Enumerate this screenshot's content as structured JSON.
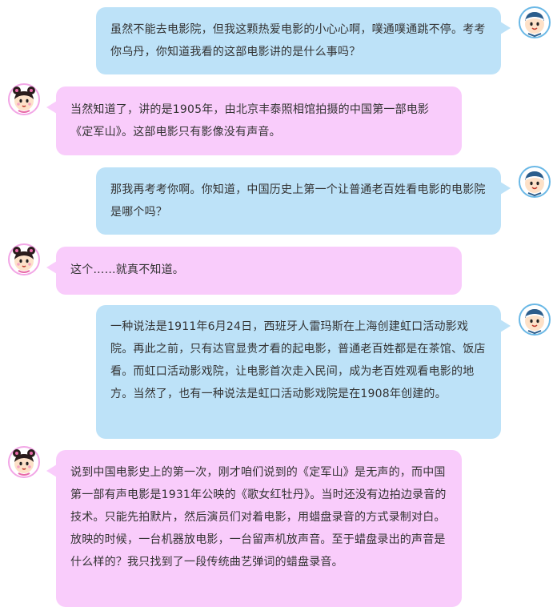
{
  "conversation": {
    "messages": [
      {
        "speaker": "boy",
        "side": "right",
        "text": "虽然不能去电影院，但我这颗热爱电影的小心心啊，噗通噗通跳不停。考考你乌丹，你知道我看的这部电影讲的是什么事吗？"
      },
      {
        "speaker": "girl",
        "side": "left",
        "text": "当然知道了，讲的是1905年，由北京丰泰照相馆拍摄的中国第一部电影《定军山》。这部电影只有影像没有声音。"
      },
      {
        "speaker": "boy",
        "side": "right",
        "text": "那我再考考你啊。你知道，中国历史上第一个让普通老百姓看电影的电影院是哪个吗？"
      },
      {
        "speaker": "girl",
        "side": "left",
        "text": "这个……就真不知道。"
      },
      {
        "speaker": "boy",
        "side": "right",
        "text": "一种说法是1911年6月24日，西班牙人雷玛斯在上海创建虹口活动影戏院。再此之前，只有达官显贵才看的起电影，普通老百姓都是在茶馆、饭店看。而虹口活动影戏院，让电影首次走入民间，成为老百姓观看电影的地方。当然了，也有一种说法是虹口活动影戏院是在1908年创建的。"
      },
      {
        "speaker": "girl",
        "side": "left",
        "text": "说到中国电影史上的第一次，刚才咱们说到的《定军山》是无声的，而中国第一部有声电影是1931年公映的《歌女红牡丹》。当时还没有边拍边录音的技术。只能先拍默片，然后演员们对着电影，用蜡盘录音的方式录制对白。放映的时候，一台机器放电影，一台留声机放声音。至于蜡盘录出的声音是什么样的？我只找到了一段传统曲艺弹词的蜡盘录音。"
      }
    ]
  },
  "colors": {
    "right_bubble": "#bde2f8",
    "left_bubble": "#f9ccfb",
    "text": "#333333"
  },
  "icons": {
    "boy_avatar": "boy-cartoon-avatar",
    "girl_avatar": "girl-cartoon-avatar"
  }
}
